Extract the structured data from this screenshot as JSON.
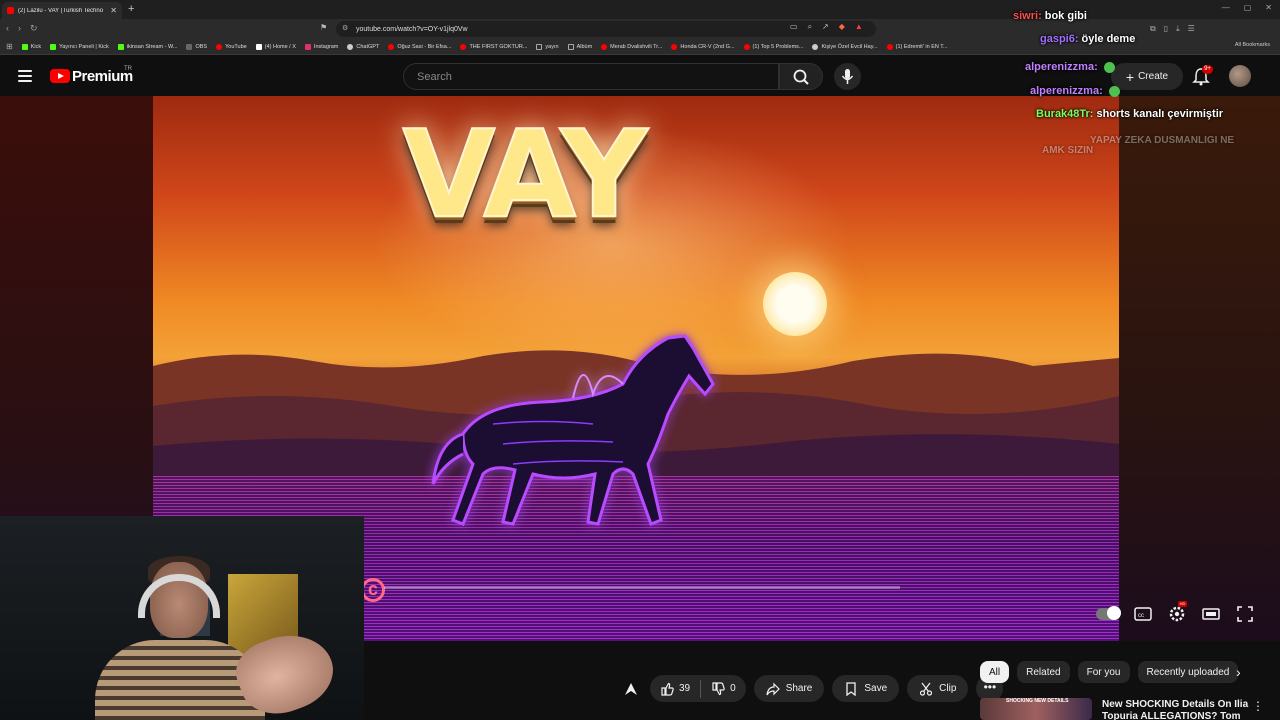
{
  "browser": {
    "tab_title": "(2) Lazilu - VAY (Turkish Techno",
    "new_tab_symbol": "+",
    "url": "youtube.com/watch?v=OY-v1jlq0Vw",
    "bookmarks": [
      {
        "label": "Kick",
        "color": "#53fc18"
      },
      {
        "label": "Yayıncı Paneli | Kick",
        "color": "#53fc18"
      },
      {
        "label": "ikinsan Stream - W...",
        "color": "#53fc18"
      },
      {
        "label": "OBS",
        "color": "#666666"
      },
      {
        "label": "YouTube",
        "color": "#ff0000"
      },
      {
        "label": "(4) Home / X",
        "color": "#ffffff"
      },
      {
        "label": "Instagram",
        "color": "#e1306c"
      },
      {
        "label": "ChatGPT",
        "color": "#cccccc"
      },
      {
        "label": "Oğuz Sasi - Bir Efsa...",
        "color": "#ff0000"
      },
      {
        "label": "THE FIRST GOKTUR...",
        "color": "#ff0000"
      },
      {
        "label": "yayın",
        "color": "#888888"
      },
      {
        "label": "Albüm",
        "color": "#888888"
      },
      {
        "label": "Merab Dvalishvili Tr...",
        "color": "#ff0000"
      },
      {
        "label": "Honda CR-V (2nd G...",
        "color": "#ff0000"
      },
      {
        "label": "(1) Top 5 Problems...",
        "color": "#ff0000"
      },
      {
        "label": "Kişiye Özel Evcil Hay...",
        "color": "#cccccc"
      },
      {
        "label": "(1) Edremit' in EN T...",
        "color": "#ff0000"
      }
    ],
    "all_bookmarks_label": "All Bookmarks"
  },
  "masthead": {
    "logo_text": "Premium",
    "region": "TR",
    "search_placeholder": "Search",
    "create_label": "Create",
    "notification_count": "9+"
  },
  "video": {
    "title_art": "VAY",
    "watermark": "c"
  },
  "chat": [
    {
      "user": "siwri:",
      "message": "bok gibi",
      "color": "#ff4d4d"
    },
    {
      "user": "gaspi6:",
      "message": "öyle deme",
      "color": "#a070ff"
    },
    {
      "user": "alperenizzma:",
      "message": "",
      "color": "#c080ff"
    },
    {
      "user": "alperenizzma:",
      "message": "",
      "color": "#c080ff"
    },
    {
      "user": "Burak48Tr:",
      "message": "shorts kanalı çevirmiştir",
      "color": "#7cff5a"
    },
    {
      "user": "",
      "message": "YAPAY ZEKA DUSMANLIGI NE",
      "color": "#ffffff"
    },
    {
      "user": "",
      "message": "AMK SIZIN",
      "color": "#ffffff"
    }
  ],
  "actions": {
    "like_count": "39",
    "dislike_count": "0",
    "share_label": "Share",
    "save_label": "Save",
    "clip_label": "Clip",
    "more_label": "•••"
  },
  "chips": [
    "All",
    "Related",
    "For you",
    "Recently uploaded"
  ],
  "recommendation": {
    "thumb_text": "SHOCKING NEW DETAILS",
    "title": "New SHOCKING Details On Ilia Topuria ALLEGATIONS? Tom"
  },
  "colors": {
    "accent": "#ff0000",
    "background": "#0f0f0f",
    "pill": "#272727"
  }
}
